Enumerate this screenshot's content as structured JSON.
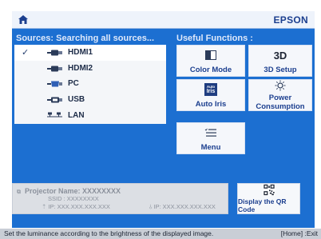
{
  "header": {
    "brand": "EPSON",
    "home_icon": "home-icon"
  },
  "sources": {
    "title": "Sources: Searching all sources...",
    "items": [
      {
        "label": "HDMI1",
        "icon": "hdmi-icon",
        "selected": true
      },
      {
        "label": "HDMI2",
        "icon": "hdmi-icon",
        "selected": false
      },
      {
        "label": "PC",
        "icon": "vga-icon",
        "selected": false
      },
      {
        "label": "USB",
        "icon": "usb-icon",
        "selected": false
      },
      {
        "label": "LAN",
        "icon": "lan-icon",
        "selected": false
      }
    ]
  },
  "functions": {
    "title": "Useful Functions :",
    "color_mode": "Color Mode",
    "setup_3d": "3D Setup",
    "auto_iris": "Auto Iris",
    "power": "Power Consumption",
    "menu": "Menu",
    "icon_3d_text": "3D",
    "icon_iris_text_top": "Auto",
    "icon_iris_text_bottom": "Iris"
  },
  "info": {
    "projector_name": "Projector Name: XXXXXXXX",
    "ssid": "SSID : XXXXXXXX",
    "ip_wireless": "IP:  XXX.XXX.XXX.XXX",
    "ip_wired": "IP:  XXX.XXX.XXX.XXX"
  },
  "qr": {
    "label": "Display the QR Code"
  },
  "status": {
    "message": "Set the luminance according to the brightness of the displayed image.",
    "hint": "[Home] :Exit"
  },
  "colors": {
    "background": "#1c6fd1",
    "accent_text": "#1c3f8f",
    "status_bar": "#c9ced6"
  }
}
